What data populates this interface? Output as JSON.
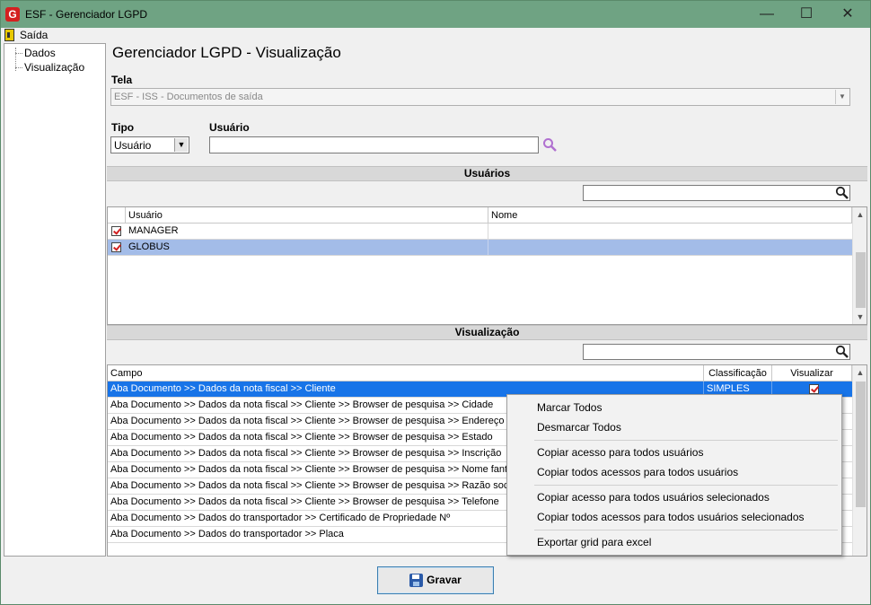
{
  "window": {
    "title": "ESF - Gerenciador LGPD",
    "app_icon_letter": "G",
    "minimize": "—",
    "maximize": "☐",
    "close": "✕"
  },
  "menu": {
    "exit_label": "Saída"
  },
  "sidebar": {
    "items": [
      {
        "label": "Dados"
      },
      {
        "label": "Visualização"
      }
    ]
  },
  "page_title": "Gerenciador LGPD - Visualização",
  "tela": {
    "label": "Tela",
    "value": "ESF - ISS - Documentos de saída"
  },
  "tipo": {
    "label": "Tipo",
    "value": "Usuário"
  },
  "usuario": {
    "label": "Usuário",
    "value": ""
  },
  "users_section": {
    "title": "Usuários",
    "search_value": "",
    "columns": [
      "Usuário",
      "Nome"
    ],
    "rows": [
      {
        "checked": true,
        "usuario": "MANAGER",
        "nome": ""
      },
      {
        "checked": true,
        "usuario": "GLOBUS",
        "nome": ""
      }
    ]
  },
  "view_section": {
    "title": "Visualização",
    "search_value": "",
    "columns": [
      "Campo",
      "Classificação",
      "Visualizar"
    ],
    "rows": [
      {
        "campo": "Aba Documento >> Dados da nota fiscal >> Cliente",
        "classificacao": "SIMPLES",
        "visualizar": true
      },
      {
        "campo": "Aba Documento >> Dados da nota fiscal >> Cliente >> Browser de pesquisa >> Cidade",
        "classificacao": "",
        "visualizar": false
      },
      {
        "campo": "Aba Documento >> Dados da nota fiscal >> Cliente >> Browser de pesquisa >> Endereço",
        "classificacao": "",
        "visualizar": false
      },
      {
        "campo": "Aba Documento >> Dados da nota fiscal >> Cliente >> Browser de pesquisa >> Estado",
        "classificacao": "",
        "visualizar": false
      },
      {
        "campo": "Aba Documento >> Dados da nota fiscal >> Cliente >> Browser de pesquisa >> Inscrição",
        "classificacao": "",
        "visualizar": false
      },
      {
        "campo": "Aba Documento >> Dados da nota fiscal >> Cliente >> Browser de pesquisa >> Nome fantasia",
        "classificacao": "",
        "visualizar": false
      },
      {
        "campo": "Aba Documento >> Dados da nota fiscal >> Cliente >> Browser de pesquisa >> Razão social",
        "classificacao": "",
        "visualizar": false
      },
      {
        "campo": "Aba Documento >> Dados da nota fiscal >> Cliente >> Browser de pesquisa >> Telefone",
        "classificacao": "",
        "visualizar": false
      },
      {
        "campo": "Aba Documento >> Dados do transportador >> Certificado de Propriedade Nº",
        "classificacao": "",
        "visualizar": false
      },
      {
        "campo": "Aba Documento >> Dados do transportador >> Placa",
        "classificacao": "",
        "visualizar": false
      }
    ]
  },
  "context_menu": {
    "groups": [
      [
        "Marcar Todos",
        "Desmarcar Todos"
      ],
      [
        "Copiar acesso para todos usuários",
        "Copiar todos acessos para todos usuários"
      ],
      [
        "Copiar acesso para todos usuários selecionados",
        "Copiar todos acessos para todos usuários selecionados"
      ],
      [
        "Exportar grid para excel"
      ]
    ]
  },
  "save_button": {
    "label": "Gravar"
  },
  "colors": {
    "titlebar": "#6fa383",
    "selected_row": "#1874e8",
    "highlight_row": "#a3bce8",
    "checkmark": "#d02020",
    "search_icon_users": "#222222",
    "search_icon_usuario": "#b070d0"
  },
  "icons": [
    "app-logo-icon",
    "exit-door-icon",
    "search-icon",
    "save-disk-icon",
    "checkbox-icon",
    "dropdown-arrow-icon"
  ]
}
